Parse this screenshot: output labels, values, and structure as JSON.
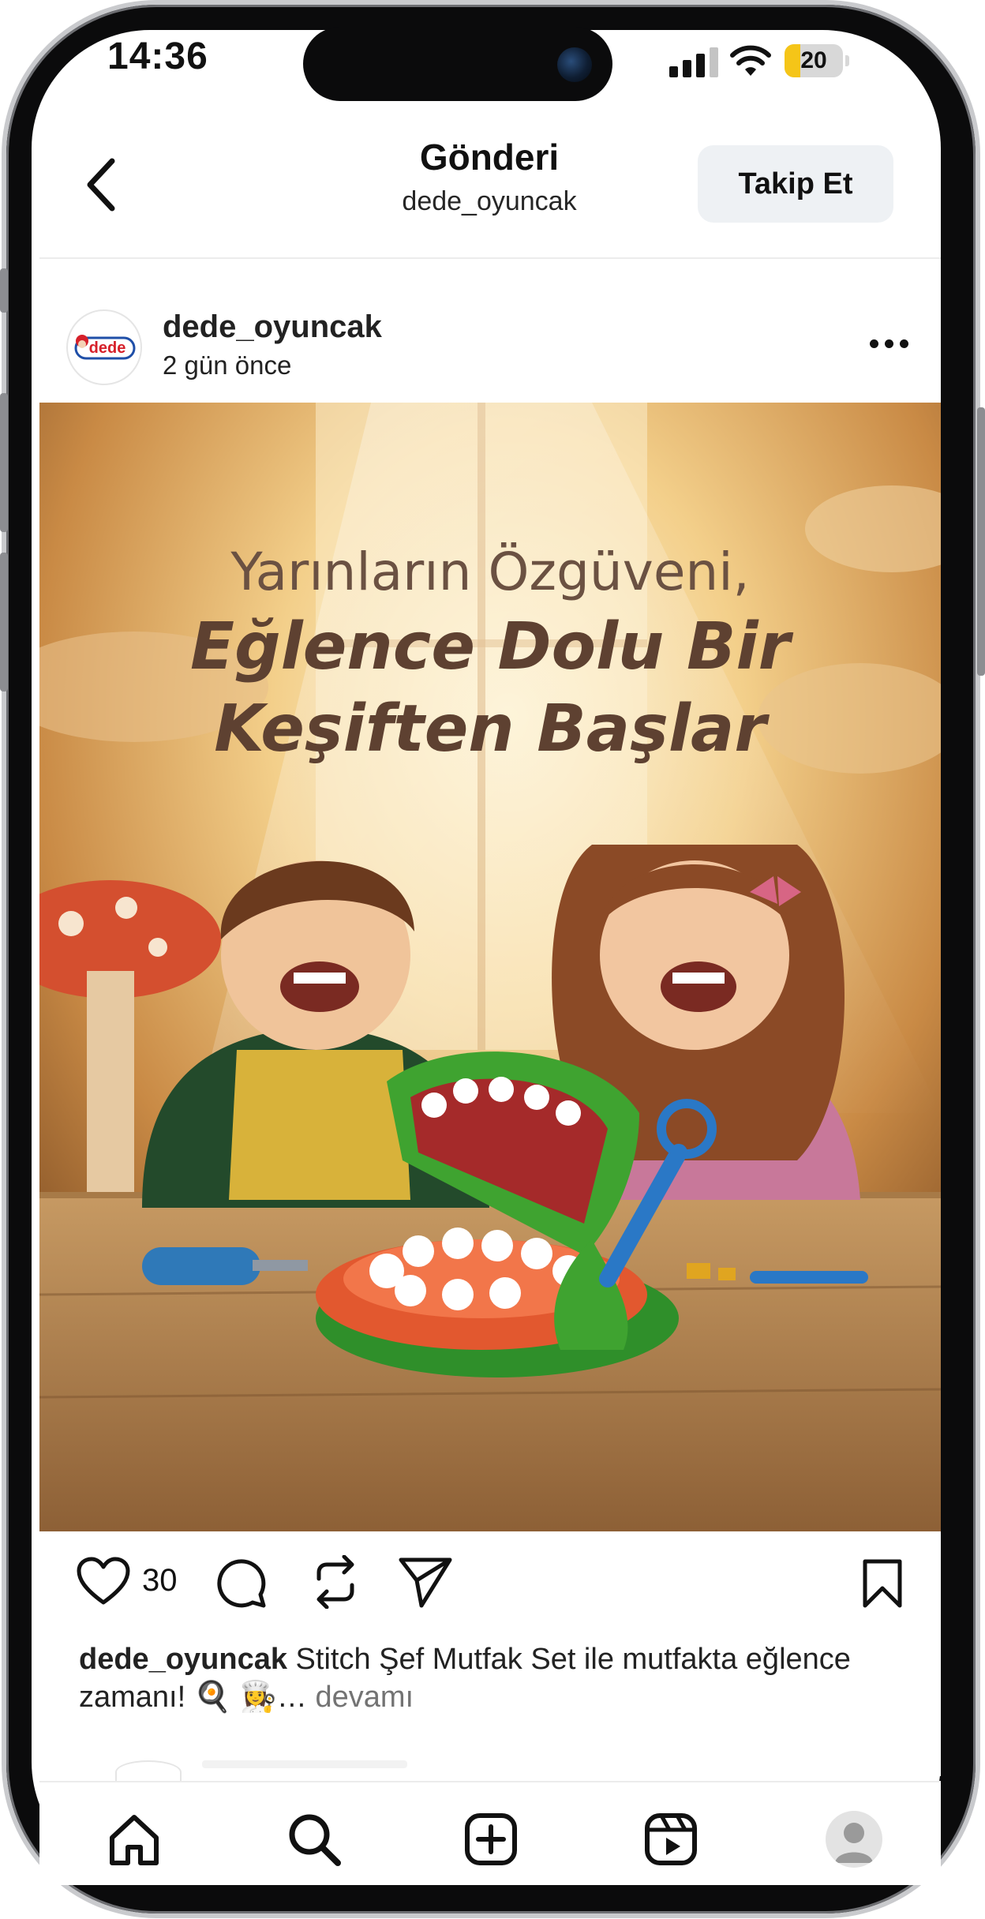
{
  "status_bar": {
    "time": "14:36",
    "battery": "20"
  },
  "header": {
    "title": "Gönderi",
    "subtitle": "dede_oyuncak",
    "follow_label": "Takip Et"
  },
  "post": {
    "username": "dede_oyuncak",
    "time_ago": "2 gün önce",
    "avatar_logo_text": "dede",
    "image": {
      "headline_line1": "Yarınların Özgüveni,",
      "headline_line2": "Eğlence Dolu Bir",
      "headline_line3": "Keşiften Başlar"
    },
    "like_count": "30",
    "caption_user": "dede_oyuncak",
    "caption_text": " Stitch Şef Mutfak Set ile mutfakta eğlence zamanı! 🍳 👩‍🍳… ",
    "caption_more": "devamı"
  },
  "colors": {
    "accent_follow_bg": "#eef1f4",
    "text": "#111111",
    "muted": "#737373",
    "battery": "#f5c518"
  },
  "icons": {
    "back": "chevron-left-icon",
    "more": "more-dots-icon",
    "like": "heart-icon",
    "comment": "comment-icon",
    "repost": "repost-icon",
    "share": "send-icon",
    "save": "bookmark-icon",
    "tabs": [
      "home-icon",
      "search-icon",
      "create-icon",
      "reels-icon",
      "profile-icon"
    ]
  }
}
